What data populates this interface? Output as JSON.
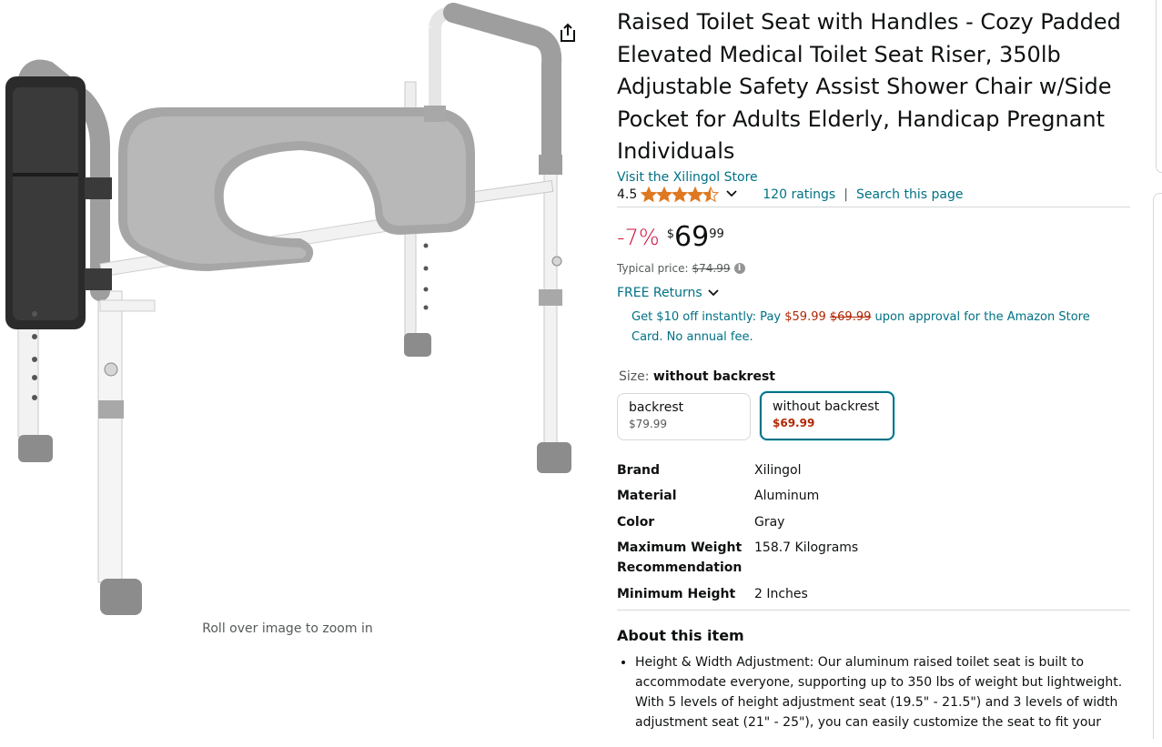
{
  "image": {
    "alt": "Raised toilet seat with handles",
    "zoom_hint": "Roll over image to zoom in",
    "share_icon": "share-icon"
  },
  "product": {
    "title": "Raised Toilet Seat with Handles - Cozy Padded Elevated Medical Toilet Seat Riser, 350lb Adjustable Safety Assist Shower Chair w/Side Pocket for Adults Elderly, Handicap Pregnant Individuals",
    "store_link": "Visit the Xilingol Store",
    "rating_value": "4.5",
    "rating_stars": 4.5,
    "ratings_count": "120 ratings",
    "separator": "|",
    "search_page": "Search this page"
  },
  "price": {
    "discount": "-7%",
    "symbol": "$",
    "whole": "69",
    "fraction": "99",
    "typical_label": "Typical price:",
    "typical_value": "$74.99"
  },
  "returns": "FREE Returns",
  "promo": {
    "prefix": "Get $10 off instantly: Pay",
    "sale_price": "$59.99",
    "old_price": "$69.99",
    "suffix": "upon approval for the Amazon Store Card. No annual fee."
  },
  "size": {
    "label": "Size:",
    "selected": "without backrest",
    "options": [
      {
        "name": "backrest",
        "price": "$79.99"
      },
      {
        "name": "without backrest",
        "price": "$69.99"
      }
    ]
  },
  "specs": [
    {
      "key": "Brand",
      "value": "Xilingol"
    },
    {
      "key": "Material",
      "value": "Aluminum"
    },
    {
      "key": "Color",
      "value": "Gray"
    },
    {
      "key": "Maximum Weight Recommendation",
      "value": "158.7 Kilograms"
    },
    {
      "key": "Minimum Height",
      "value": "2 Inches"
    }
  ],
  "about": {
    "title": "About this item",
    "bullets": [
      "Height & Width Adjustment: Our aluminum raised toilet seat is built to accommodate everyone, supporting up to 350 lbs of weight but lightweight. With 5 levels of height adjustment seat (19.5\" - 21.5\") and 3 levels of width adjustment seat (21\" - 25\"), you can easily customize the seat to fit your"
    ]
  },
  "colors": {
    "link": "#007185",
    "discount": "#cc0c39",
    "sale_price": "#b12704",
    "star": "#de7921",
    "selected_border": "#007185"
  }
}
